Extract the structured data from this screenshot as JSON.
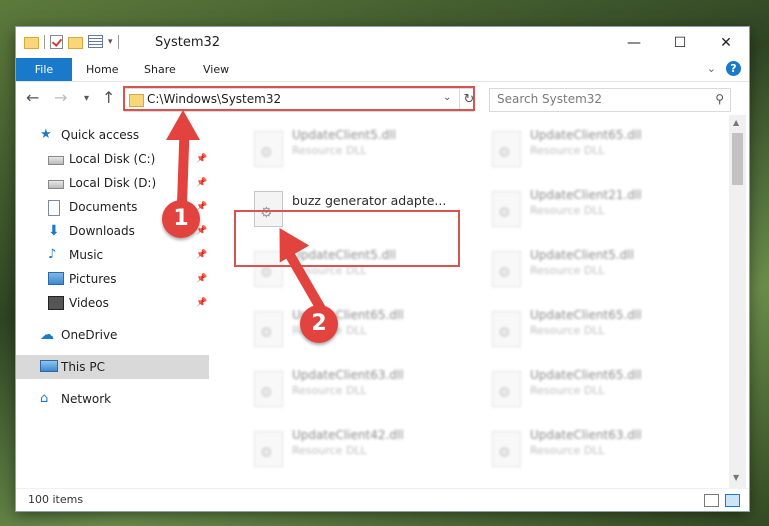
{
  "window": {
    "title": "System32",
    "controls": {
      "minimize": "—",
      "maximize": "☐",
      "close": "✕"
    }
  },
  "ribbon": {
    "tabs": [
      "File",
      "Home",
      "Share",
      "View"
    ],
    "help": "?"
  },
  "address": {
    "path": "C:\\Windows\\System32",
    "search_placeholder": "Search System32"
  },
  "sidebar": {
    "items": [
      {
        "label": "Quick access",
        "icon": "star-icon",
        "pinned": false
      },
      {
        "label": "Local Disk (C:)",
        "icon": "drive-icon",
        "pinned": true
      },
      {
        "label": "Local Disk (D:)",
        "icon": "drive-icon",
        "pinned": true
      },
      {
        "label": "Documents",
        "icon": "documents-icon",
        "pinned": true
      },
      {
        "label": "Downloads",
        "icon": "download-icon",
        "pinned": true
      },
      {
        "label": "Music",
        "icon": "music-icon",
        "pinned": true
      },
      {
        "label": "Pictures",
        "icon": "pictures-icon",
        "pinned": true
      },
      {
        "label": "Videos",
        "icon": "videos-icon",
        "pinned": true
      },
      {
        "label": "OneDrive",
        "icon": "cloud-icon",
        "pinned": false
      },
      {
        "label": "This PC",
        "icon": "computer-icon",
        "pinned": false,
        "selected": true
      },
      {
        "label": "Network",
        "icon": "network-icon",
        "pinned": false
      }
    ]
  },
  "files": {
    "left": [
      {
        "name": "UpdateClient5.dll",
        "type": "Resource DLL"
      },
      {
        "name": "buzz generator adapte...",
        "type": ""
      },
      {
        "name": "UpdateClient5.dll",
        "type": "Resource DLL"
      },
      {
        "name": "UpdateClient65.dll",
        "type": "Resource DLL"
      },
      {
        "name": "UpdateClient63.dll",
        "type": "Resource DLL"
      },
      {
        "name": "UpdateClient42.dll",
        "type": "Resource DLL"
      }
    ],
    "right": [
      {
        "name": "UpdateClient65.dll",
        "type": "Resource DLL"
      },
      {
        "name": "UpdateClient21.dll",
        "type": "Resource DLL"
      },
      {
        "name": "UpdateClient5.dll",
        "type": "Resource DLL"
      },
      {
        "name": "UpdateClient65.dll",
        "type": "Resource DLL"
      },
      {
        "name": "UpdateClient65.dll",
        "type": "Resource DLL"
      },
      {
        "name": "UpdateClient63.dll",
        "type": "Resource DLL"
      }
    ]
  },
  "status": {
    "item_count": "100 items"
  },
  "annotations": {
    "step1": "1",
    "step2": "2",
    "color": "#e2433f"
  }
}
